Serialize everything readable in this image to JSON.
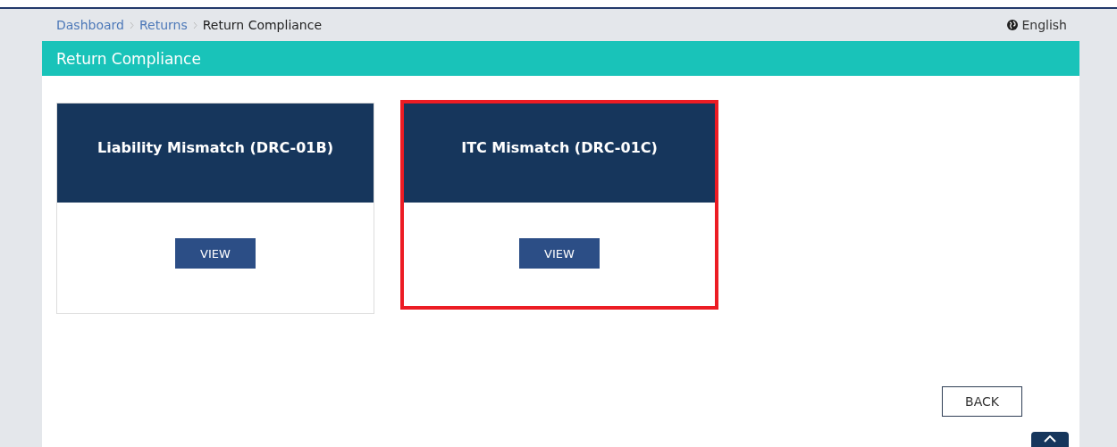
{
  "breadcrumb": [
    {
      "label": "Dashboard",
      "kind": "link"
    },
    {
      "label": "Returns",
      "kind": "link"
    },
    {
      "label": "Return Compliance",
      "kind": "current"
    }
  ],
  "language": {
    "label": "English"
  },
  "panel": {
    "title": "Return Compliance"
  },
  "cards": [
    {
      "title": "Liability Mismatch (DRC-01B)",
      "button": "VIEW",
      "highlighted": false
    },
    {
      "title": "ITC Mismatch (DRC-01C)",
      "button": "VIEW",
      "highlighted": true
    }
  ],
  "back_button": "BACK"
}
